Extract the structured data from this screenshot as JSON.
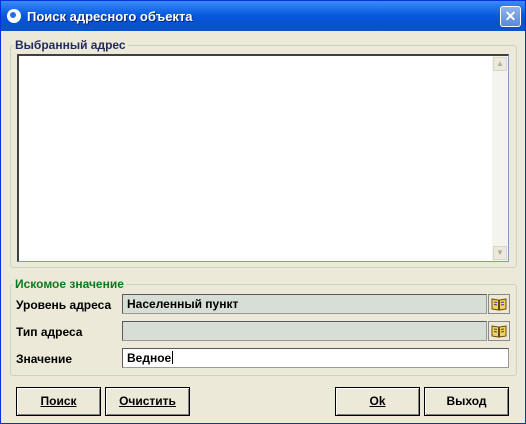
{
  "window": {
    "title": "Поиск адресного объекта",
    "close_symbol": "✕"
  },
  "selected_group": {
    "legend": "Выбранный адрес",
    "address_text": ""
  },
  "search_group": {
    "legend": "Искомое значение",
    "level": {
      "label": "Уровень адреса",
      "value": "Населенный пункт"
    },
    "type": {
      "label": "Тип адреса",
      "value": ""
    },
    "value": {
      "label": "Значение",
      "value": "Ведное"
    }
  },
  "buttons": {
    "search": "Поиск",
    "clear": "Очистить",
    "ok": "Ok",
    "exit": "Выход"
  },
  "icons": [
    "app-icon",
    "close-icon",
    "book-icon",
    "scroll-up-arrow-icon",
    "scroll-down-arrow-icon"
  ]
}
